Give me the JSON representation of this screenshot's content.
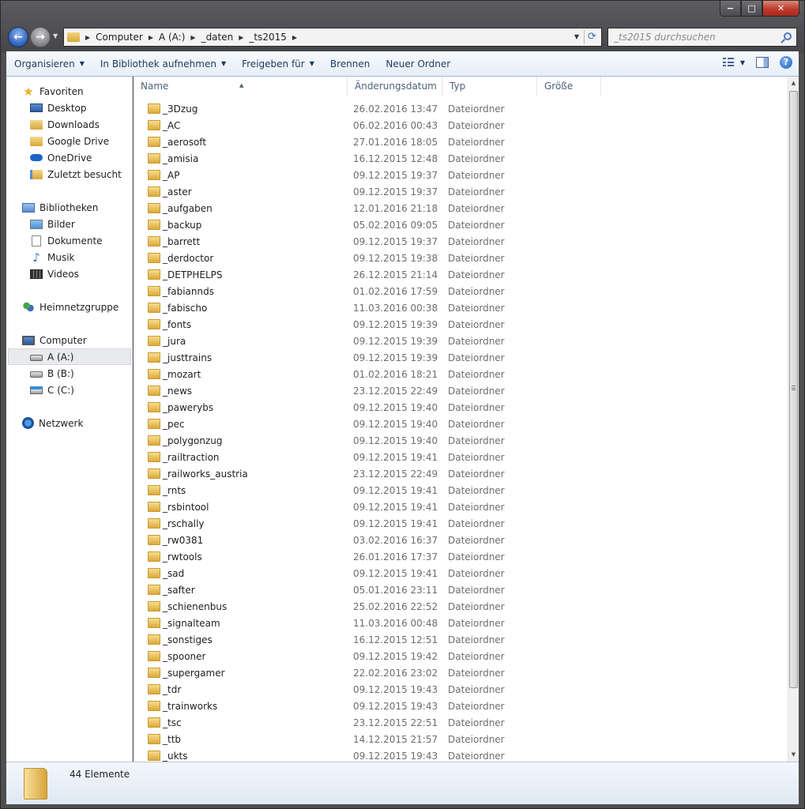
{
  "window": {
    "min": "−",
    "max": "□",
    "close": "✕"
  },
  "address": {
    "crumbs": [
      "Computer",
      "A (A:)",
      "_daten",
      "_ts2015"
    ],
    "search_placeholder": "_ts2015 durchsuchen"
  },
  "toolbar": {
    "organize": "Organisieren",
    "library": "In Bibliothek aufnehmen",
    "share": "Freigeben für",
    "burn": "Brennen",
    "new_folder": "Neuer Ordner",
    "help": "?"
  },
  "sidebar": {
    "favorites": "Favoriten",
    "fav_items": [
      "Desktop",
      "Downloads",
      "Google Drive",
      "OneDrive",
      "Zuletzt besucht"
    ],
    "libraries": "Bibliotheken",
    "lib_items": [
      "Bilder",
      "Dokumente",
      "Musik",
      "Videos"
    ],
    "homegroup": "Heimnetzgruppe",
    "computer": "Computer",
    "drives": [
      "A (A:)",
      "B (B:)",
      "C (C:)"
    ],
    "network": "Netzwerk"
  },
  "columns": {
    "name": "Name",
    "date": "Änderungsdatum",
    "type": "Typ",
    "size": "Größe"
  },
  "files": [
    {
      "name": "_3Dzug",
      "date": "26.02.2016 13:47",
      "type": "Dateiordner"
    },
    {
      "name": "_AC",
      "date": "06.02.2016 00:43",
      "type": "Dateiordner"
    },
    {
      "name": "_aerosoft",
      "date": "27.01.2016 18:05",
      "type": "Dateiordner"
    },
    {
      "name": "_amisia",
      "date": "16.12.2015 12:48",
      "type": "Dateiordner"
    },
    {
      "name": "_AP",
      "date": "09.12.2015 19:37",
      "type": "Dateiordner"
    },
    {
      "name": "_aster",
      "date": "09.12.2015 19:37",
      "type": "Dateiordner"
    },
    {
      "name": "_aufgaben",
      "date": "12.01.2016 21:18",
      "type": "Dateiordner"
    },
    {
      "name": "_backup",
      "date": "05.02.2016 09:05",
      "type": "Dateiordner"
    },
    {
      "name": "_barrett",
      "date": "09.12.2015 19:37",
      "type": "Dateiordner"
    },
    {
      "name": "_derdoctor",
      "date": "09.12.2015 19:38",
      "type": "Dateiordner"
    },
    {
      "name": "_DETPHELPS",
      "date": "26.12.2015 21:14",
      "type": "Dateiordner"
    },
    {
      "name": "_fabiannds",
      "date": "01.02.2016 17:59",
      "type": "Dateiordner"
    },
    {
      "name": "_fabischo",
      "date": "11.03.2016 00:38",
      "type": "Dateiordner"
    },
    {
      "name": "_fonts",
      "date": "09.12.2015 19:39",
      "type": "Dateiordner"
    },
    {
      "name": "_jura",
      "date": "09.12.2015 19:39",
      "type": "Dateiordner"
    },
    {
      "name": "_justtrains",
      "date": "09.12.2015 19:39",
      "type": "Dateiordner"
    },
    {
      "name": "_mozart",
      "date": "01.02.2016 18:21",
      "type": "Dateiordner"
    },
    {
      "name": "_news",
      "date": "23.12.2015 22:49",
      "type": "Dateiordner"
    },
    {
      "name": "_pawerybs",
      "date": "09.12.2015 19:40",
      "type": "Dateiordner"
    },
    {
      "name": "_pec",
      "date": "09.12.2015 19:40",
      "type": "Dateiordner"
    },
    {
      "name": "_polygonzug",
      "date": "09.12.2015 19:40",
      "type": "Dateiordner"
    },
    {
      "name": "_railtraction",
      "date": "09.12.2015 19:41",
      "type": "Dateiordner"
    },
    {
      "name": "_railworks_austria",
      "date": "23.12.2015 22:49",
      "type": "Dateiordner"
    },
    {
      "name": "_rnts",
      "date": "09.12.2015 19:41",
      "type": "Dateiordner"
    },
    {
      "name": "_rsbintool",
      "date": "09.12.2015 19:41",
      "type": "Dateiordner"
    },
    {
      "name": "_rschally",
      "date": "09.12.2015 19:41",
      "type": "Dateiordner"
    },
    {
      "name": "_rw0381",
      "date": "03.02.2016 16:37",
      "type": "Dateiordner"
    },
    {
      "name": "_rwtools",
      "date": "26.01.2016 17:37",
      "type": "Dateiordner"
    },
    {
      "name": "_sad",
      "date": "09.12.2015 19:41",
      "type": "Dateiordner"
    },
    {
      "name": "_safter",
      "date": "05.01.2016 23:11",
      "type": "Dateiordner"
    },
    {
      "name": "_schienenbus",
      "date": "25.02.2016 22:52",
      "type": "Dateiordner"
    },
    {
      "name": "_signalteam",
      "date": "11.03.2016 00:48",
      "type": "Dateiordner"
    },
    {
      "name": "_sonstiges",
      "date": "16.12.2015 12:51",
      "type": "Dateiordner"
    },
    {
      "name": "_spooner",
      "date": "09.12.2015 19:42",
      "type": "Dateiordner"
    },
    {
      "name": "_supergamer",
      "date": "22.02.2016 23:02",
      "type": "Dateiordner"
    },
    {
      "name": "_tdr",
      "date": "09.12.2015 19:43",
      "type": "Dateiordner"
    },
    {
      "name": "_trainworks",
      "date": "09.12.2015 19:43",
      "type": "Dateiordner"
    },
    {
      "name": "_tsc",
      "date": "23.12.2015 22:51",
      "type": "Dateiordner"
    },
    {
      "name": "_ttb",
      "date": "14.12.2015 21:57",
      "type": "Dateiordner"
    },
    {
      "name": "_ukts",
      "date": "09.12.2015 19:43",
      "type": "Dateiordner"
    }
  ],
  "status": {
    "count": "44 Elemente"
  }
}
